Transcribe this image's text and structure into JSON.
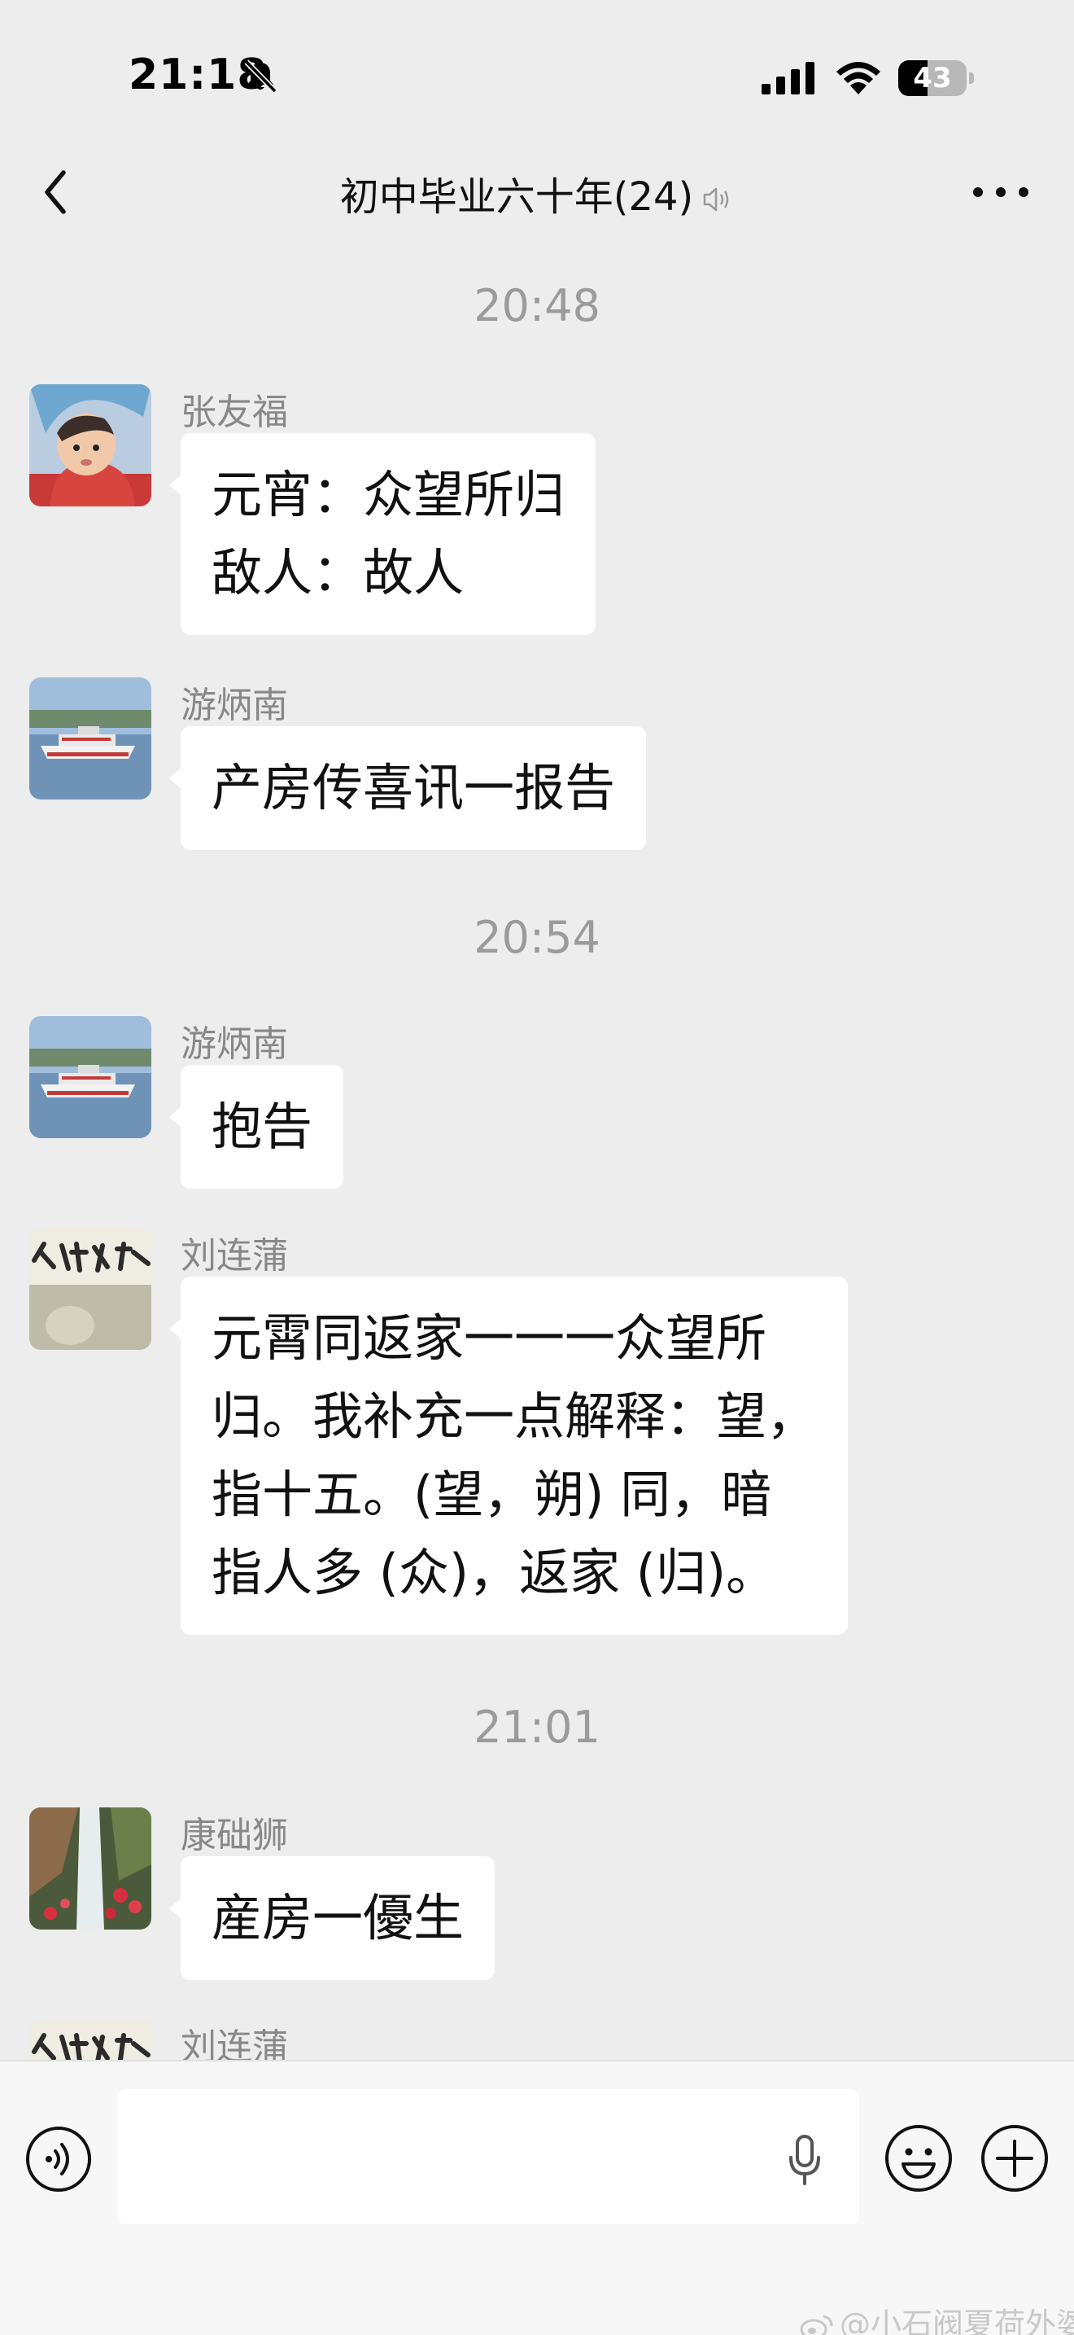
{
  "status_bar": {
    "time": "21:18",
    "battery_level": "43",
    "battery_fraction": 0.43
  },
  "nav": {
    "title": "初中毕业六十年(24)"
  },
  "chat": {
    "timestamps": [
      "20:48",
      "20:54",
      "21:01"
    ],
    "messages": [
      {
        "sender": "张友福",
        "avatar": "baby-photo-avatar",
        "lines": [
          "元宵：众望所归",
          "敌人：故人"
        ]
      },
      {
        "sender": "游炳南",
        "avatar": "ferry-boat-avatar",
        "lines": [
          "产房传喜讯一报告"
        ]
      },
      {
        "sender": "游炳南",
        "avatar": "ferry-boat-avatar",
        "lines": [
          "抱告"
        ]
      },
      {
        "sender": "刘连蒲",
        "avatar": "calligraphy-avatar",
        "lines": [
          "元霄同返家一一一众望所",
          "归。我补充一点解释：望，",
          "指十五。(望，朔) 同，暗",
          "指人多 (众)，返家 (归)。"
        ]
      },
      {
        "sender": "康础狮",
        "avatar": "waterfall-flowers-avatar",
        "lines": [
          "産房一優生"
        ]
      },
      {
        "sender": "刘连蒲",
        "avatar": "calligraphy-avatar",
        "lines": []
      }
    ]
  },
  "input_bar": {
    "text_value": "",
    "icons": [
      "voice-icon",
      "mic-icon",
      "emoji-icon",
      "plus-icon"
    ]
  },
  "watermark": {
    "text": "@小石阀夏荷外婆"
  },
  "colors": {
    "background": "#ededed",
    "bubble": "#ffffff",
    "timestamp": "#9b9b9b",
    "sender": "#888888"
  }
}
